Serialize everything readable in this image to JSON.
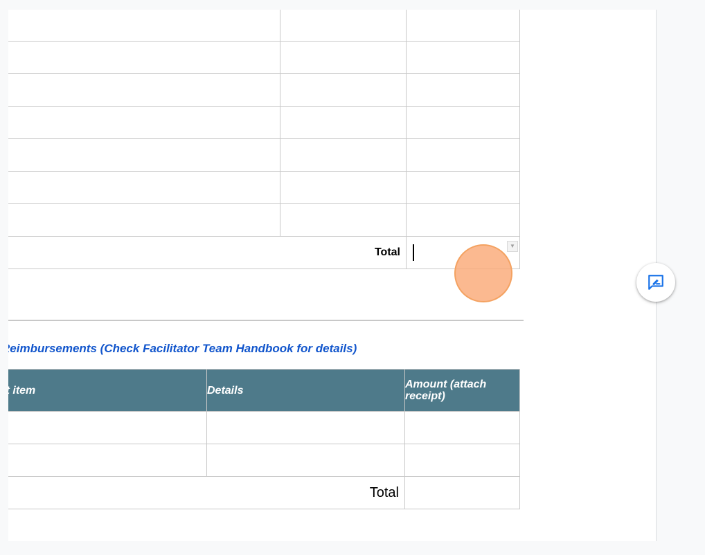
{
  "expenses_table": {
    "empty_rows": 7,
    "total_label": "Total",
    "total_value": ""
  },
  "reimbursements": {
    "section_title": "Reimbursements (Check Facilitator Team Handbook for details)",
    "headers": [
      "Reimbursement item",
      "Details",
      "Amount (attach receipt)"
    ],
    "empty_rows": 2,
    "total_label": "Total",
    "total_value": ""
  },
  "sidebar": {
    "comment_icon": "add-comment-icon"
  },
  "colors": {
    "header_bg": "#4e7a8a",
    "section_title": "#1155cc",
    "comment_icon": "#1a73e8",
    "cursor_highlight": "#f4a261"
  }
}
